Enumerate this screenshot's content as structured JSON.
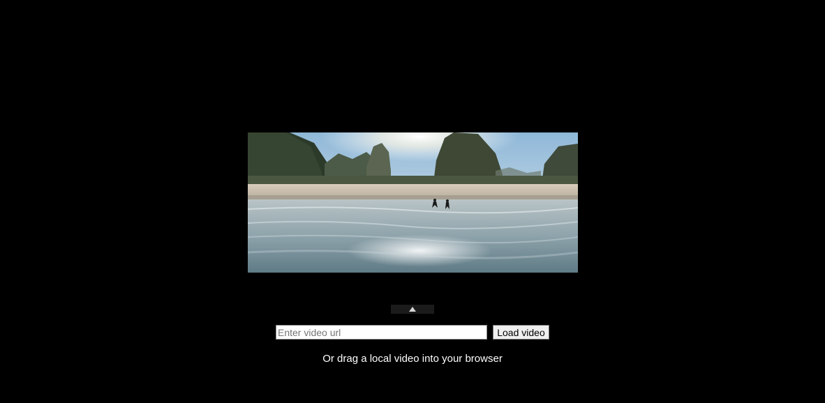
{
  "video": {
    "scene": "beach-cliffs-sunset-video-frame"
  },
  "controls": {
    "toggle_icon": "triangle-up-icon",
    "url_placeholder": "Enter video url",
    "url_value": "",
    "load_label": "Load video"
  },
  "hint": {
    "text": "Or drag a local video into your browser"
  },
  "colors": {
    "background": "#000000",
    "text": "#ffffff",
    "toggle_bg": "#1b1b1b"
  }
}
